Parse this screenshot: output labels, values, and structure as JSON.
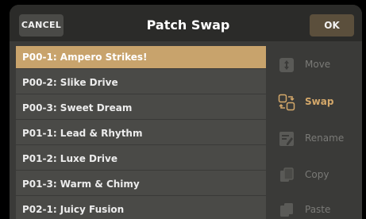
{
  "header": {
    "cancel_label": "CANCEL",
    "title": "Patch Swap",
    "ok_label": "OK"
  },
  "patches": [
    {
      "label": "P00-1: Ampero Strikes!",
      "selected": true
    },
    {
      "label": "P00-2: Slike Drive",
      "selected": false
    },
    {
      "label": "P00-3: Sweet Dream",
      "selected": false
    },
    {
      "label": "P01-1: Lead & Rhythm",
      "selected": false
    },
    {
      "label": "P01-2: Luxe Drive",
      "selected": false
    },
    {
      "label": "P01-3: Warm & Chimy",
      "selected": false
    },
    {
      "label": "P02-1: Juicy Fusion",
      "selected": false
    }
  ],
  "actions": [
    {
      "label": "Move",
      "icon": "move-icon",
      "active": false
    },
    {
      "label": "Swap",
      "icon": "swap-icon",
      "active": true
    },
    {
      "label": "Rename",
      "icon": "rename-icon",
      "active": false
    },
    {
      "label": "Copy",
      "icon": "copy-icon",
      "active": false
    },
    {
      "label": "Paste",
      "icon": "paste-icon",
      "active": false
    }
  ],
  "colors": {
    "accent": "#c8a36c",
    "active_action": "#d4a86a",
    "disabled_action": "#7a7a77"
  }
}
